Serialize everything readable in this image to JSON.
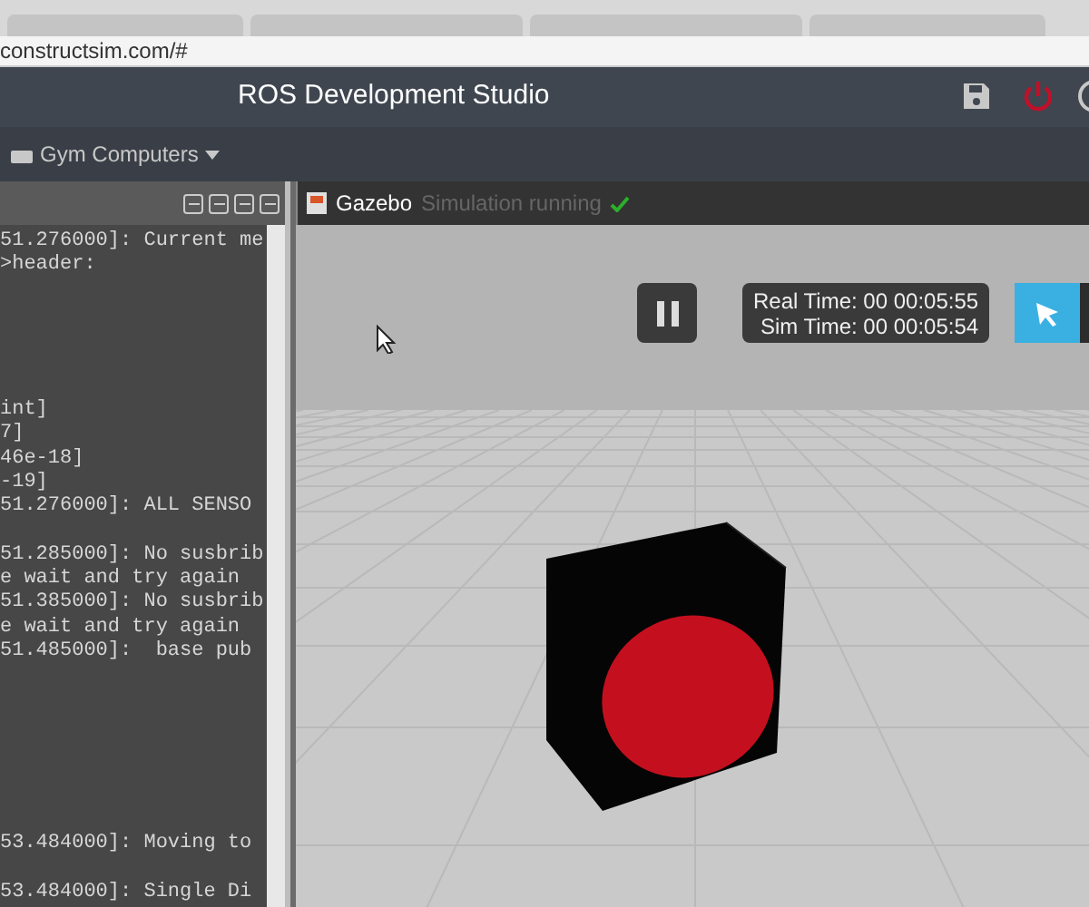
{
  "browser": {
    "address": "constructsim.com/#"
  },
  "header": {
    "title": "ROS Development Studio"
  },
  "toolbar": {
    "menu": "Gym Computers"
  },
  "terminal": {
    "lines": [
      {
        "kind": "text",
        "text": "51.276000]: Current me"
      },
      {
        "kind": "text",
        "text": ">header:"
      },
      {
        "kind": "blank"
      },
      {
        "kind": "blank"
      },
      {
        "kind": "blank"
      },
      {
        "kind": "blank"
      },
      {
        "kind": "blank"
      },
      {
        "kind": "text",
        "text": "int]"
      },
      {
        "kind": "text",
        "text": "7]"
      },
      {
        "kind": "text",
        "text": "46e-18]"
      },
      {
        "kind": "text",
        "text": "-19]"
      },
      {
        "kind": "text",
        "text": "51.276000]: ALL SENSO"
      },
      {
        "kind": "blank"
      },
      {
        "kind": "text",
        "text": "51.285000]: No susbrib"
      },
      {
        "kind": "text",
        "text": "e wait and try again"
      },
      {
        "kind": "text",
        "text": "51.385000]: No susbrib"
      },
      {
        "kind": "text",
        "text": "e wait and try again"
      },
      {
        "kind": "text",
        "text": "51.485000]:  base pub"
      },
      {
        "kind": "blank"
      },
      {
        "kind": "blank"
      },
      {
        "kind": "blank"
      },
      {
        "kind": "blank"
      },
      {
        "kind": "blank"
      },
      {
        "kind": "blank"
      },
      {
        "kind": "blank"
      },
      {
        "kind": "text",
        "text": "53.484000]: Moving to"
      },
      {
        "kind": "blank"
      },
      {
        "kind": "text",
        "text": "53.484000]: Single Di"
      }
    ]
  },
  "gazebo": {
    "title": "Gazebo",
    "status": "Simulation running",
    "running": true,
    "real_time": "Real Time: 00 00:05:55",
    "sim_time": "Sim Time: 00 00:05:54",
    "select_tool": {
      "selected": true
    }
  }
}
